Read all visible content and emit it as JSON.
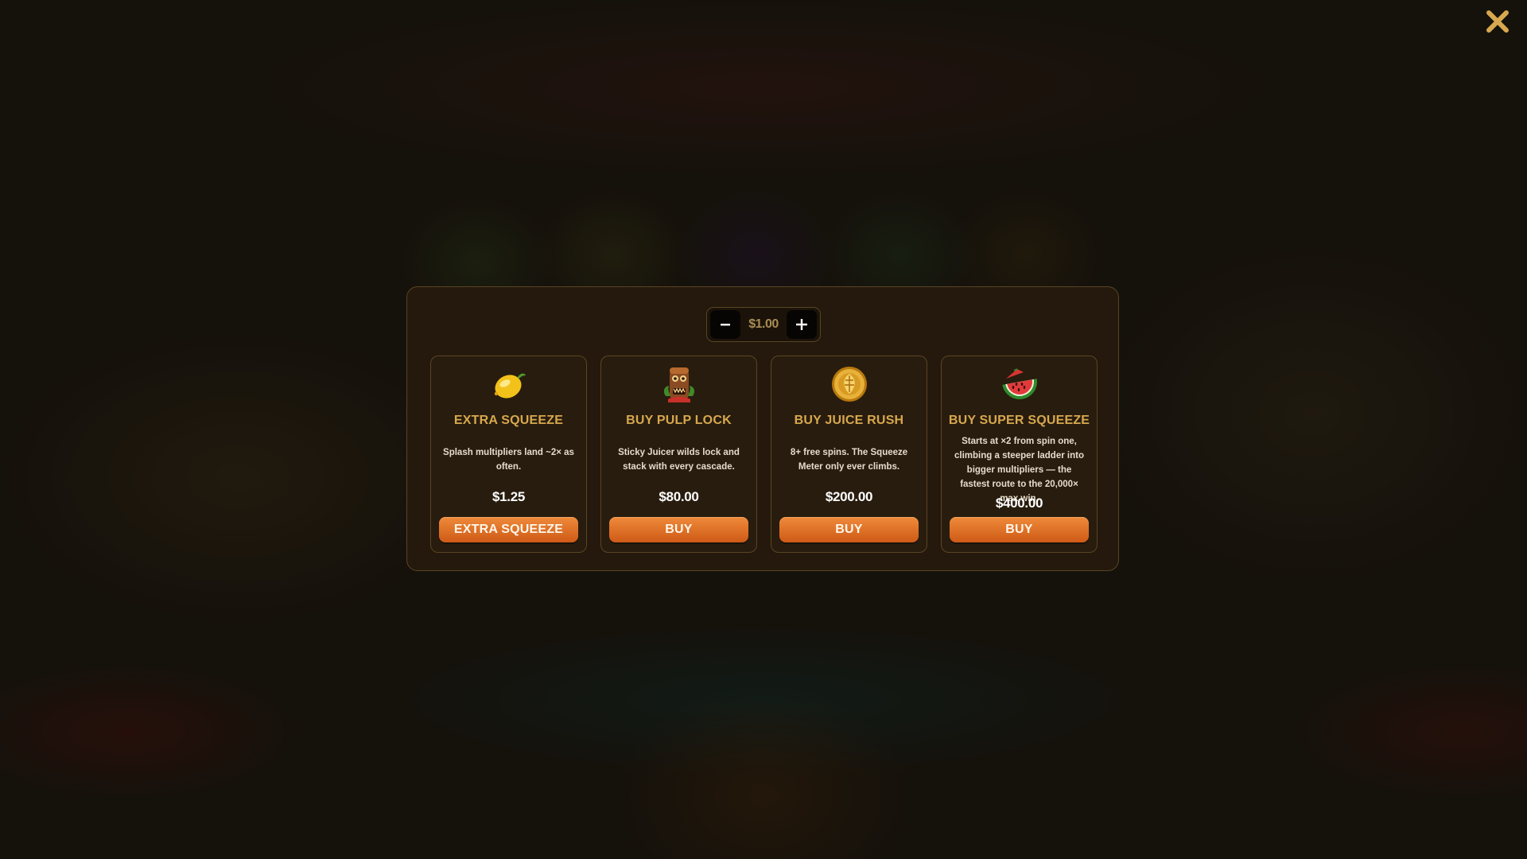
{
  "stake": {
    "minus_label": "−",
    "plus_label": "+",
    "value": "$1.00"
  },
  "cards": [
    {
      "icon": "lemon-icon",
      "title": "EXTRA SQUEEZE",
      "description": "Splash multipliers land ~2× as often.",
      "price": "$1.25",
      "button_label": "EXTRA SQUEEZE"
    },
    {
      "icon": "tiki-mask-icon",
      "title": "BUY PULP LOCK",
      "description": "Sticky Juicer wilds lock and stack with every cascade.",
      "price": "$80.00",
      "button_label": "BUY"
    },
    {
      "icon": "gold-coin-icon",
      "title": "BUY JUICE RUSH",
      "description": "8+ free spins. The Squeeze Meter only ever climbs.",
      "price": "$200.00",
      "button_label": "BUY"
    },
    {
      "icon": "watermelon-icon",
      "title": "BUY SUPER SQUEEZE",
      "description": "Starts at ×2 from spin one, climbing a steeper ladder into bigger multipliers — the fastest route to the 20,000× max win.",
      "price": "$400.00",
      "button_label": "BUY"
    }
  ],
  "colors": {
    "accent_title": "#d7a84e",
    "button_orange": "#e2712a",
    "panel_border": "#5a4524",
    "close_icon": "#d7a84e"
  }
}
